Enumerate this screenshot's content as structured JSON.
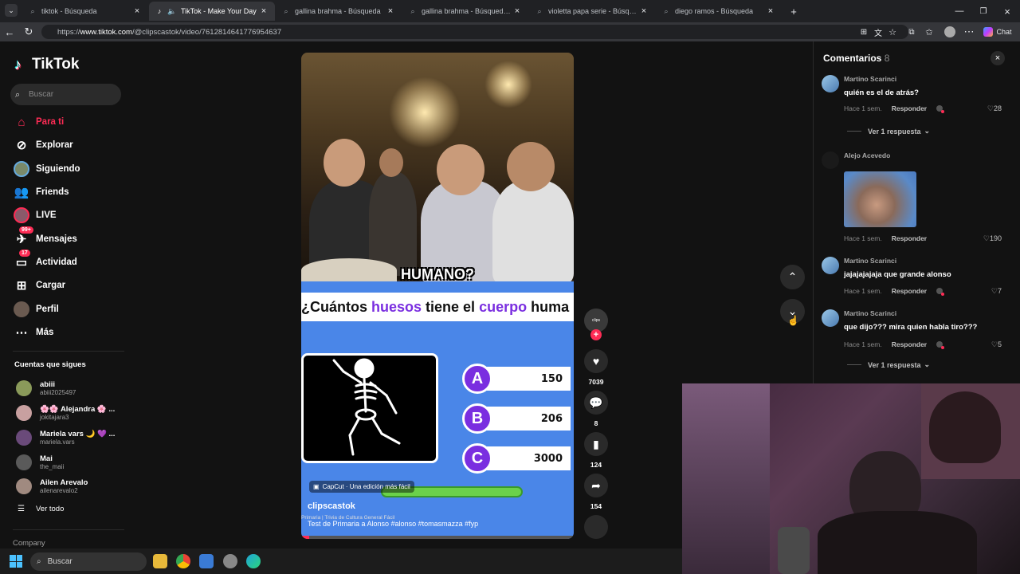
{
  "browser": {
    "tabs": [
      {
        "title": "tiktok - Búsqueda",
        "active": false
      },
      {
        "title": "TikTok - Make Your Day",
        "active": true
      },
      {
        "title": "gallina brahma - Búsqueda",
        "active": false
      },
      {
        "title": "gallina brahma - Búsqueda Imáge",
        "active": false
      },
      {
        "title": "violetta papa serie - Búsqueda Im",
        "active": false
      },
      {
        "title": "diego ramos - Búsqueda",
        "active": false
      }
    ],
    "url_prefix": "https://",
    "url_host": "www.tiktok.com",
    "url_path": "/@clipscastok/video/7612814641776954637",
    "chat_label": "Chat"
  },
  "sidebar": {
    "logo": "TikTok",
    "search_placeholder": "Buscar",
    "nav": [
      {
        "label": "Para ti",
        "icon": "home-icon",
        "active": true
      },
      {
        "label": "Explorar",
        "icon": "compass-icon"
      },
      {
        "label": "Siguiendo",
        "icon": "following-avatar-icon"
      },
      {
        "label": "Friends",
        "icon": "friends-icon"
      },
      {
        "label": "LIVE",
        "icon": "live-icon"
      },
      {
        "label": "Mensajes",
        "icon": "messages-icon",
        "badge": "99+"
      },
      {
        "label": "Actividad",
        "icon": "activity-icon",
        "badge": "17"
      },
      {
        "label": "Cargar",
        "icon": "upload-icon"
      },
      {
        "label": "Perfil",
        "icon": "profile-avatar-icon"
      },
      {
        "label": "Más",
        "icon": "more-icon"
      }
    ],
    "following_header": "Cuentas que sigues",
    "following": [
      {
        "name": "abiii",
        "user": "abiii2025497"
      },
      {
        "name": "🌸🌸 Alejandra 🌸 ...",
        "user": "jokitajara3"
      },
      {
        "name": "Mariela vars 🌙 💜 ...",
        "user": "mariela.vars"
      },
      {
        "name": "Mai",
        "user": "the_maii"
      },
      {
        "name": "Ailen Arevalo",
        "user": "ailenarevalo2"
      }
    ],
    "see_all": "Ver todo",
    "company": "Company"
  },
  "video": {
    "overlay_word": "HUMANO?",
    "question_prefix": "¿Cuántos ",
    "question_w1": "huesos",
    "question_mid": " tiene el ",
    "question_w2": "cuerpo",
    "question_suffix": " huma",
    "options": [
      {
        "letter": "A",
        "value": "150"
      },
      {
        "letter": "B",
        "value": "206"
      },
      {
        "letter": "C",
        "value": "3000"
      }
    ],
    "capcut": "CapCut · Una edición más fácil",
    "author": "clipscastok",
    "sub": "Primaria | Trivia de Cultura General Fácil",
    "description": "Test de Primaria a Alonso #alonso #tomasmazza #fyp",
    "progress_fraction": 0.03
  },
  "actions": {
    "likes": "7039",
    "comments": "8",
    "saves": "124",
    "shares": "154"
  },
  "comments_panel": {
    "title": "Comentarios",
    "count": "8",
    "items": [
      {
        "user": "Martino Scarinci",
        "text": "quién es el de atrás?",
        "time": "Hace 1 sem.",
        "reply": "Responder",
        "likes": "28",
        "view_replies": "Ver 1 respuesta"
      },
      {
        "user": "Alejo Acevedo",
        "text": "",
        "time": "Hace 1 sem.",
        "reply": "Responder",
        "likes": "190"
      },
      {
        "user": "Martino Scarinci",
        "text": "jajajajajaja que grande alonso",
        "time": "Hace 1 sem.",
        "reply": "Responder",
        "likes": "7"
      },
      {
        "user": "Martino Scarinci",
        "text": "que dijo??? mira quien habla tiro???",
        "time": "Hace 1 sem.",
        "reply": "Responder",
        "likes": "5",
        "view_replies": "Ver 1 respuesta"
      }
    ]
  },
  "taskbar": {
    "search": "Buscar"
  },
  "colors": {
    "accent": "#fe2c55",
    "purple": "#7a2ee0",
    "quiz_bg": "#4a86e8"
  }
}
